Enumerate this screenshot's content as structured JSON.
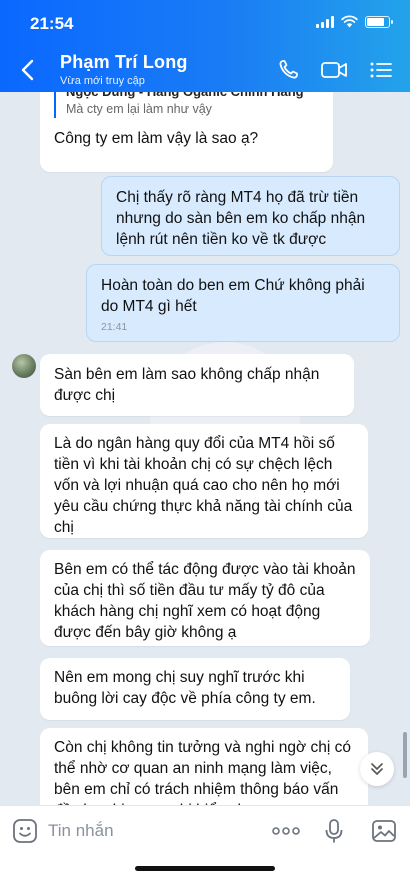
{
  "status_bar": {
    "time": "21:54"
  },
  "header": {
    "contact_name": "Phạm Trí Long",
    "contact_status": "Vừa mới truy cập",
    "icons": {
      "back": "chevron-left-icon",
      "call": "phone-icon",
      "video": "video-icon",
      "menu": "list-menu-icon"
    }
  },
  "messages": [
    {
      "direction": "in",
      "quote": {
        "title": "Ngọc Dung - Hàng Oganic Chính Hãng",
        "text": "Mà cty em lại làm như vậy"
      },
      "text": "Công ty em làm vậy là sao ạ?"
    },
    {
      "direction": "out",
      "text": "Chị thấy rõ ràng MT4 họ đã trừ tiền nhưng do sàn bên em ko chấp nhận lệnh rút nên tiền ko về tk được"
    },
    {
      "direction": "out",
      "text": "Hoàn toàn do ben em Chứ không phải do MT4 gì hết",
      "time": "21:41"
    },
    {
      "direction": "in",
      "text": "Sàn bên em làm sao không chấp nhận được chị"
    },
    {
      "direction": "in",
      "text": "Là do ngân hàng quy đổi của MT4 hồi số tiền vì khi tài khoản chị có sự chệch lệch vốn và lợi nhuận quá cao cho nên họ mới yêu cầu chứng thực khả năng tài chính của chị"
    },
    {
      "direction": "in",
      "text": "Bên em có thể tác động được vào tài khoản của chị thì số tiền đầu tư mấy tỷ đô của khách hàng chị nghĩ xem có hoạt động được đến bây giờ không ạ"
    },
    {
      "direction": "in",
      "text": "Nên em mong chị suy nghĩ trước khi buông lời cay độc về phía công ty em."
    },
    {
      "direction": "in",
      "text": "Còn chị không tin tưởng và nghi ngờ chị có thể nhờ cơ quan an ninh mạng làm việc, bên em chỉ có trách nhiệm thông báo vấn đề cho chị mong chị hiểu cho e"
    }
  ],
  "composer": {
    "placeholder": "Tin nhắn",
    "icons": {
      "sticker": "sticker-smile-icon",
      "more": "more-dots-icon",
      "voice": "microphone-icon",
      "image": "image-icon"
    }
  },
  "scroll_down_icon": "chevron-double-down-icon",
  "colors": {
    "header_start": "#0a68ff",
    "header_end": "#23a3ea",
    "outgoing_bubble": "#d7eafe",
    "chat_bg": "#e2e9f1",
    "accent": "#0068ff"
  }
}
